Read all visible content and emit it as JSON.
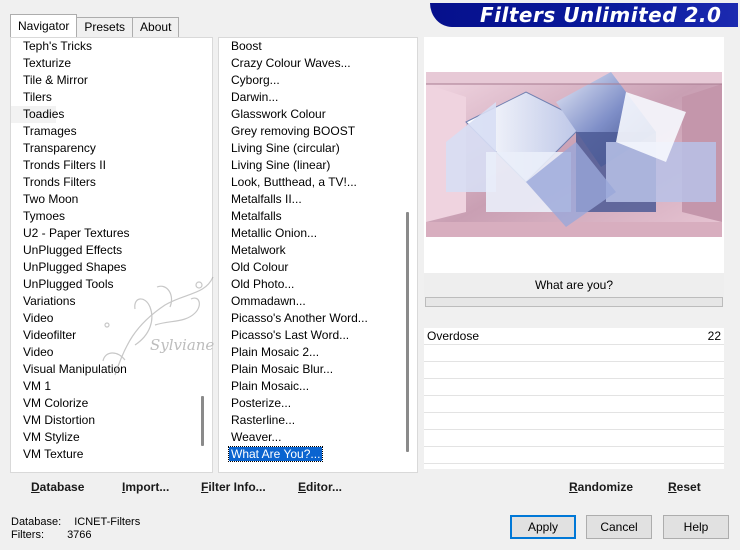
{
  "tabs": [
    {
      "label": "Navigator",
      "active": true
    },
    {
      "label": "Presets",
      "active": false
    },
    {
      "label": "About",
      "active": false
    }
  ],
  "banner": {
    "title": "Filters Unlimited 2.0"
  },
  "categories": {
    "items": [
      "Teph's Tricks",
      "Texturize",
      "Tile & Mirror",
      "Tilers",
      "Toadies",
      "Tramages",
      "Transparency",
      "Tronds Filters II",
      "Tronds Filters",
      "Two Moon",
      "Tymoes",
      "U2 - Paper Textures",
      "UnPlugged Effects",
      "UnPlugged Shapes",
      "UnPlugged Tools",
      "Variations",
      "Video",
      "Videofilter",
      "Video",
      "Visual Manipulation",
      "VM 1",
      "VM Colorize",
      "VM Distortion",
      "VM Stylize",
      "VM Texture"
    ],
    "highlighted": "Toadies"
  },
  "filters": {
    "items": [
      "Boost",
      "Crazy Colour Waves...",
      "Cyborg...",
      "Darwin...",
      "Glasswork Colour",
      "Grey removing BOOST",
      "Living Sine (circular)",
      "Living Sine (linear)",
      "Look, Butthead, a TV!...",
      "Metalfalls II...",
      "Metalfalls",
      "Metallic Onion...",
      "Metalwork",
      "Old Colour",
      "Old Photo...",
      "Ommadawn...",
      "Picasso's Another Word...",
      "Picasso's Last Word...",
      "Plain Mosaic 2...",
      "Plain Mosaic Blur...",
      "Plain Mosaic...",
      "Posterize...",
      "Rasterline...",
      "Weaver..."
    ],
    "selected": "What Are You?..."
  },
  "preview": {
    "filter_title": "What are you?",
    "params": [
      {
        "name": "Overdose",
        "value": "22"
      }
    ],
    "empty_rows": 7
  },
  "toolbar": {
    "database": "Database",
    "import": "Import...",
    "filter_info": "Filter Info...",
    "editor": "Editor...",
    "randomize": "Randomize",
    "reset": "Reset"
  },
  "status": {
    "database_label": "Database:",
    "database_value": "ICNET-Filters",
    "filters_label": "Filters:",
    "filters_value": "3766"
  },
  "buttons": {
    "apply": "Apply",
    "cancel": "Cancel",
    "help": "Help"
  },
  "watermark": {
    "text": "Sylviane"
  },
  "colors": {
    "banner": "#06108c",
    "selection": "#0a64d0"
  }
}
